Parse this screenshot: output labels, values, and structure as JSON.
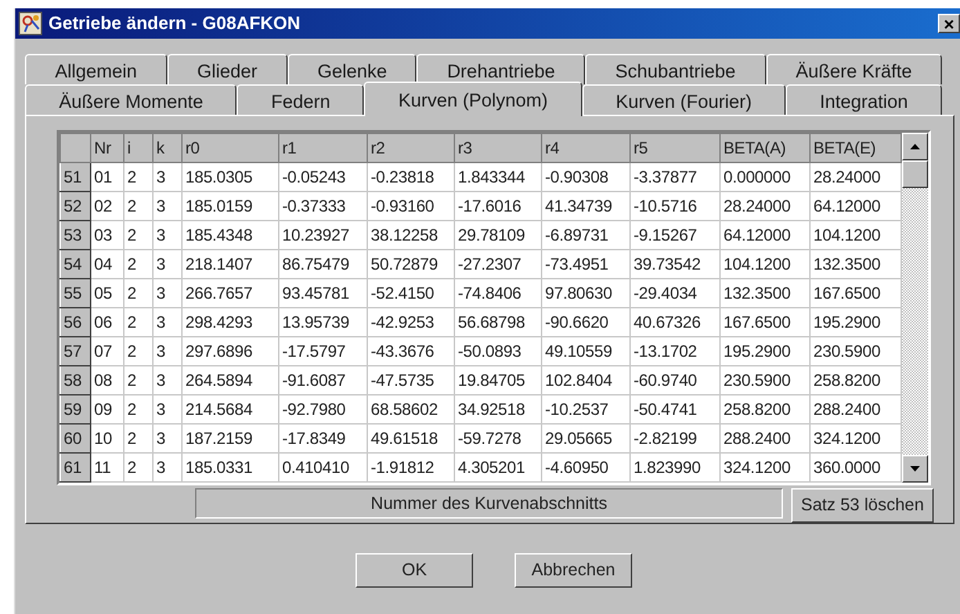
{
  "window": {
    "title": "Getriebe ändern - G08AFKON",
    "close": "×"
  },
  "tab_rows": [
    [
      {
        "label": "Allgemein",
        "selected": false
      },
      {
        "label": "Glieder",
        "selected": false
      },
      {
        "label": "Gelenke",
        "selected": false
      },
      {
        "label": "Drehantriebe",
        "selected": false
      },
      {
        "label": "Schubantriebe",
        "selected": false
      },
      {
        "label": "Äußere Kräfte",
        "selected": false
      }
    ],
    [
      {
        "label": "Äußere Momente",
        "selected": false
      },
      {
        "label": "Federn",
        "selected": false
      },
      {
        "label": "Kurven (Polynom)",
        "selected": true
      },
      {
        "label": "Kurven (Fourier)",
        "selected": false
      },
      {
        "label": "Integration",
        "selected": false
      }
    ]
  ],
  "table": {
    "columns": [
      "Nr",
      "i",
      "k",
      "r0",
      "r1",
      "r2",
      "r3",
      "r4",
      "r5",
      "BETA(A)",
      "BETA(E)"
    ],
    "rows": [
      {
        "header": "51",
        "cells": [
          "01",
          "2",
          "3",
          "185.0305",
          "-0.05243",
          "-0.23818",
          "1.843344",
          "-0.90308",
          "-3.37877",
          "0.000000",
          "28.24000"
        ]
      },
      {
        "header": "52",
        "cells": [
          "02",
          "2",
          "3",
          "185.0159",
          "-0.37333",
          "-0.93160",
          "-17.6016",
          "41.34739",
          "-10.5716",
          "28.24000",
          "64.12000"
        ]
      },
      {
        "header": "53",
        "cells": [
          "03",
          "2",
          "3",
          "185.4348",
          "10.23927",
          "38.12258",
          "29.78109",
          "-6.89731",
          "-9.15267",
          "64.12000",
          "104.1200"
        ]
      },
      {
        "header": "54",
        "cells": [
          "04",
          "2",
          "3",
          "218.1407",
          "86.75479",
          "50.72879",
          "-27.2307",
          "-73.4951",
          "39.73542",
          "104.1200",
          "132.3500"
        ]
      },
      {
        "header": "55",
        "cells": [
          "05",
          "2",
          "3",
          "266.7657",
          "93.45781",
          "-52.4150",
          "-74.8406",
          "97.80630",
          "-29.4034",
          "132.3500",
          "167.6500"
        ]
      },
      {
        "header": "56",
        "cells": [
          "06",
          "2",
          "3",
          "298.4293",
          "13.95739",
          "-42.9253",
          "56.68798",
          "-90.6620",
          "40.67326",
          "167.6500",
          "195.2900"
        ]
      },
      {
        "header": "57",
        "cells": [
          "07",
          "2",
          "3",
          "297.6896",
          "-17.5797",
          "-43.3676",
          "-50.0893",
          "49.10559",
          "-13.1702",
          "195.2900",
          "230.5900"
        ]
      },
      {
        "header": "58",
        "cells": [
          "08",
          "2",
          "3",
          "264.5894",
          "-91.6087",
          "-47.5735",
          "19.84705",
          "102.8404",
          "-60.9740",
          "230.5900",
          "258.8200"
        ]
      },
      {
        "header": "59",
        "cells": [
          "09",
          "2",
          "3",
          "214.5684",
          "-92.7980",
          "68.58602",
          "34.92518",
          "-10.2537",
          "-50.4741",
          "258.8200",
          "288.2400"
        ]
      },
      {
        "header": "60",
        "cells": [
          "10",
          "2",
          "3",
          "187.2159",
          "-17.8349",
          "49.61518",
          "-59.7278",
          "29.05665",
          "-2.82199",
          "288.2400",
          "324.1200"
        ]
      },
      {
        "header": "61",
        "cells": [
          "11",
          "2",
          "3",
          "185.0331",
          "0.410410",
          "-1.91812",
          "4.305201",
          "-4.60950",
          "1.823990",
          "324.1200",
          "360.0000"
        ]
      }
    ]
  },
  "status_field": "Nummer des Kurvenabschnitts",
  "delete_button": "Satz 53 löschen",
  "buttons": [
    "OK",
    "Abbrechen"
  ]
}
